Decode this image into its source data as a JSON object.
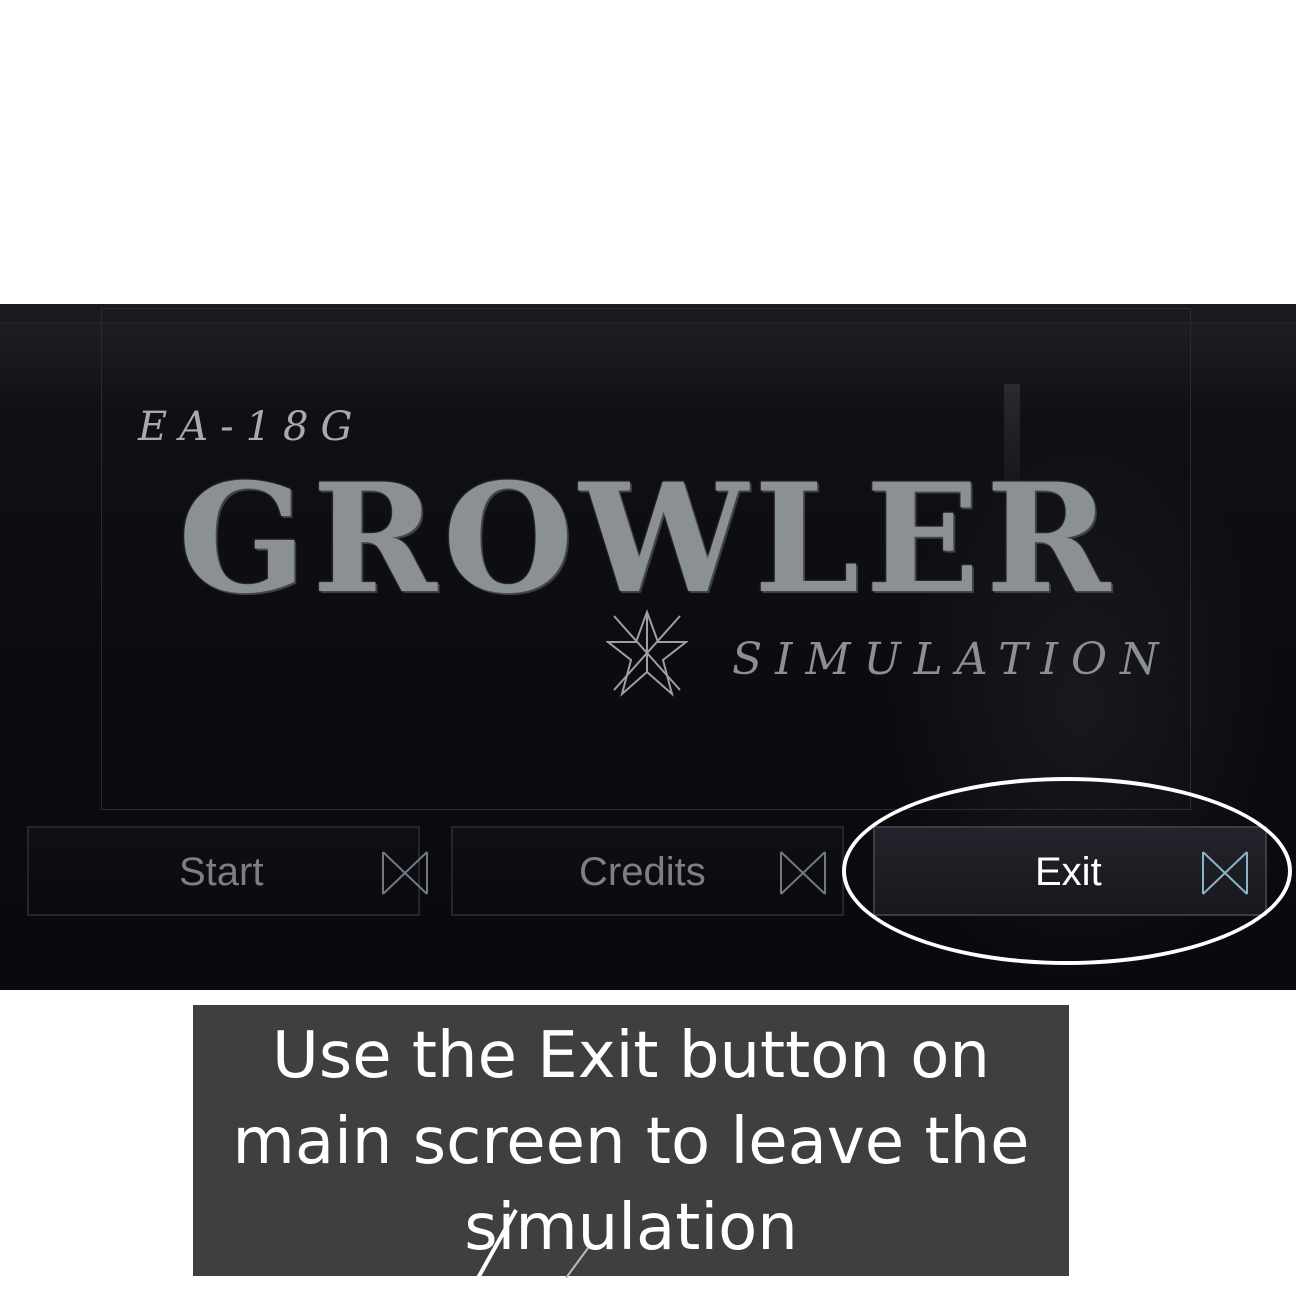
{
  "game": {
    "logo": {
      "model": "EA-18G",
      "title": "GROWLER",
      "subtitle": "SIMULATION"
    },
    "menu": {
      "start_label": "Start",
      "credits_label": "Credits",
      "exit_label": "Exit"
    }
  },
  "annotation": {
    "caption": "Use the Exit button on main screen to leave the simulation",
    "highlight_color": "#ffffff"
  },
  "icons": {
    "button_icon": "bowtie-icon",
    "emblem": "star-emblem-icon"
  }
}
